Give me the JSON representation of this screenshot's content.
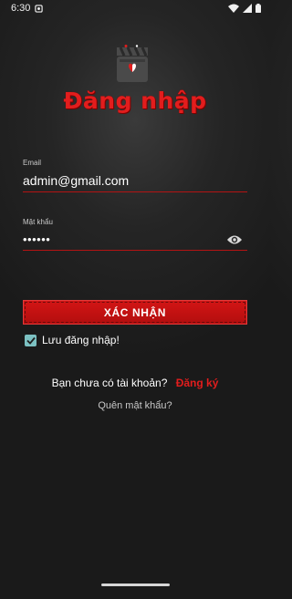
{
  "status_bar": {
    "time": "6:30"
  },
  "screen": {
    "title": "Đăng nhập"
  },
  "email": {
    "label": "Email",
    "value": "admin@gmail.com"
  },
  "password": {
    "label": "Mật khẩu",
    "value": "••••••"
  },
  "submit": {
    "label": "XÁC NHẬN"
  },
  "remember": {
    "label": "Lưu đăng nhập!",
    "checked": true
  },
  "signup": {
    "prompt": "Bạn chưa có tài khoản?",
    "link": "Đăng ký"
  },
  "forgot": {
    "label": "Quên mật khẩu?"
  },
  "colors": {
    "accent": "#e21d1d",
    "underline": "#b41313",
    "checkbox": "#7cc1c2",
    "background": "#252525"
  }
}
